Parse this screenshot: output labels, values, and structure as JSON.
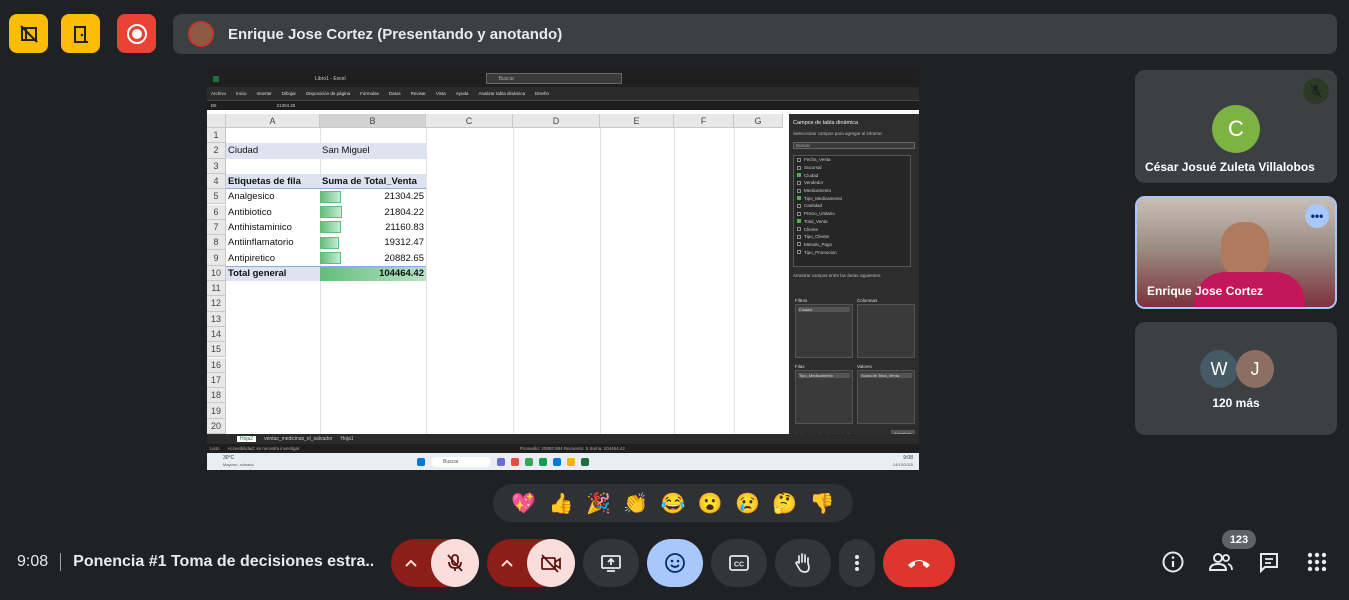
{
  "colors": {
    "bg": "#202124",
    "danger": "#ea4335",
    "amber": "#fbbc04",
    "accent_blue": "#a8c7fa",
    "muted_red": "#8c1d18",
    "pale_red": "#f9dedc"
  },
  "top": {
    "buttons": [
      {
        "icon": "hide-tiles-icon"
      },
      {
        "icon": "door-exit-icon"
      },
      {
        "icon": "record-icon"
      }
    ],
    "presenter_label": "Enrique Jose Cortez (Presentando y anotando)"
  },
  "excel": {
    "title": "Libro1 - Excel",
    "search_placeholder": "Buscar",
    "menu": [
      "Archivo",
      "Inicio",
      "Insertar",
      "Dibujar",
      "Disposición de página",
      "Fórmulas",
      "Datos",
      "Revisar",
      "Vista",
      "Ayuda",
      "Analizar tabla dinámica",
      "Diseño"
    ],
    "name_box": "B5",
    "formula": "21304.25",
    "columns": [
      "A",
      "B",
      "C",
      "D",
      "E",
      "F",
      "G"
    ],
    "rows": [
      "1",
      "2",
      "3",
      "4",
      "5",
      "6",
      "7",
      "8",
      "9",
      "10",
      "11",
      "12",
      "13",
      "14",
      "15",
      "16",
      "17",
      "18",
      "19",
      "20"
    ],
    "filter_label": "Ciudad",
    "filter_value": "San Miguel",
    "pivot_header_rows": "Etiquetas de fila",
    "pivot_header_values": "Suma de Total_Venta",
    "pivot_rows": [
      {
        "label": "Analgesico",
        "value": "21304.25",
        "fraction": 0.2
      },
      {
        "label": "Antibiotico",
        "value": "21804.22",
        "fraction": 0.21
      },
      {
        "label": "Antihistaminico",
        "value": "21160.83",
        "fraction": 0.2
      },
      {
        "label": "Antiinflamatorio",
        "value": "19312.47",
        "fraction": 0.18
      },
      {
        "label": "Antipiretico",
        "value": "20882.65",
        "fraction": 0.2
      }
    ],
    "total_label": "Total general",
    "total_value": "104464.42",
    "pane_title": "Campos de tabla dinámica",
    "pane_subtitle": "Seleccionar campos para agregar al informe:",
    "pane_search": "Buscar",
    "pane_fields": [
      {
        "name": "Fecha_Venta",
        "checked": false
      },
      {
        "name": "Sucursal",
        "checked": false
      },
      {
        "name": "Ciudad",
        "checked": true
      },
      {
        "name": "Vendedor",
        "checked": false
      },
      {
        "name": "Medicamento",
        "checked": false
      },
      {
        "name": "Tipo_Medicamento",
        "checked": true
      },
      {
        "name": "Cantidad",
        "checked": false
      },
      {
        "name": "Precio_Unitario",
        "checked": false
      },
      {
        "name": "Total_Venta",
        "checked": true
      },
      {
        "name": "Cliente",
        "checked": false
      },
      {
        "name": "Tipo_Cliente",
        "checked": false
      },
      {
        "name": "Metodo_Pago",
        "checked": false
      },
      {
        "name": "Tipo_Promocion",
        "checked": false
      }
    ],
    "pane_areas_label": "Arrastrar campos entre las áreas siguientes:",
    "area_filters": "Filtros",
    "area_columns": "Columnas",
    "area_rows": "Filas",
    "area_values": "Valores",
    "area_filters_item": "Ciudad",
    "area_rows_item": "Tipo_Medicamento",
    "area_values_item": "Suma de Total_Venta",
    "pane_defer": "Aplazar actualización del diseño",
    "pane_update": "Actualizar",
    "sheet_tabs": [
      "Hoja2",
      "ventas_medicinas_el_salvador",
      "Hoja1"
    ],
    "status": "Listo",
    "status_accessibility": "Accesibilidad: se necesita investigar",
    "status_summary": "Promedio: 20892.884   Recuento: 5   Suma: 104464.42",
    "taskbar_search": "Buscar",
    "taskbar_weather": "30°C",
    "taskbar_weather_desc": "Mayorm. soleado",
    "taskbar_time": "9:08",
    "taskbar_date": "24/10/2025"
  },
  "participants": [
    {
      "initial": "C",
      "name": "César Josué Zuleta Villalobos",
      "avatar_color": "#7cb342",
      "muted": true
    },
    {
      "name": "Enrique Jose Cortez",
      "speaking": true
    },
    {
      "initials": [
        "W",
        "J"
      ],
      "more_label": "120 más"
    }
  ],
  "reactions": [
    "💖",
    "👍",
    "🎉",
    "👏",
    "😂",
    "😮",
    "😢",
    "🤔",
    "👎"
  ],
  "bottom": {
    "time": "9:08",
    "meeting_title": "Ponencia #1 Toma de decisiones estra...",
    "participant_count": "123"
  }
}
